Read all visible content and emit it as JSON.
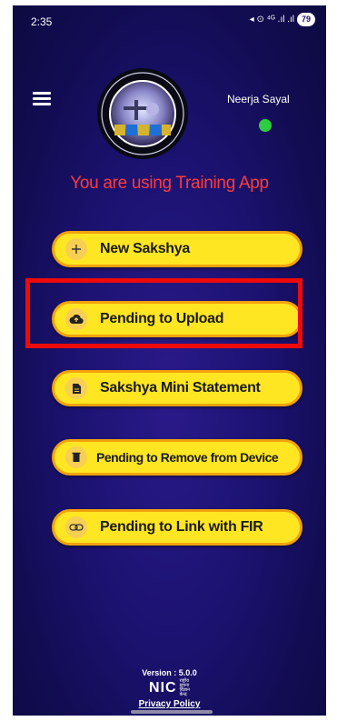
{
  "status_bar": {
    "time": "2:35",
    "icons_text": "◂ ⊙ ⁴ᴳ .ıl .ıl",
    "battery": "79"
  },
  "header": {
    "logo_icon": "cctns-emblem-logo",
    "user_name": "Neerja Sayal",
    "online_color": "#2ecc40"
  },
  "training_notice": "You are using Training App",
  "menu": {
    "items": [
      {
        "icon": "plus-icon",
        "label": "New Sakshya"
      },
      {
        "icon": "cloud-upload-icon",
        "label": "Pending to Upload"
      },
      {
        "icon": "document-icon",
        "label": "Sakshya Mini Statement"
      },
      {
        "icon": "trash-icon",
        "label": "Pending to Remove from Device"
      },
      {
        "icon": "link-icon",
        "label": "Pending to Link with FIR"
      }
    ]
  },
  "highlighted_item": "Pending to Upload",
  "footer": {
    "version": "Version : 5.0.0",
    "nic": "NIC",
    "nic_subtitle": [
      "राष्ट्रीय",
      "सूचना",
      "विज्ञान",
      "केन्द्र"
    ],
    "privacy_policy": "Privacy Policy"
  },
  "colors": {
    "button_fill": "#ffe623",
    "button_border": "#f2a20c",
    "highlight": "#ee0a0a",
    "notice_text": "#ff3b3b",
    "background": "#1b1270"
  }
}
